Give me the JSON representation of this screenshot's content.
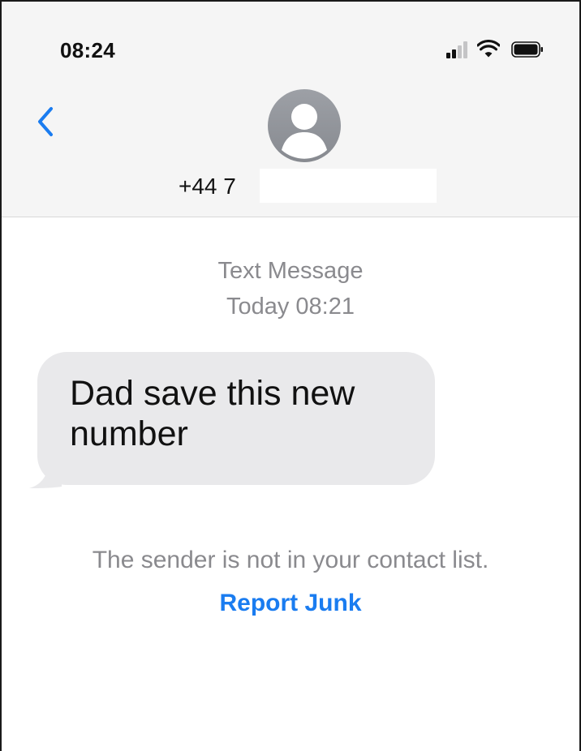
{
  "status_bar": {
    "time": "08:24",
    "icons": [
      "cellular-signal-icon",
      "wifi-icon",
      "battery-icon"
    ]
  },
  "header": {
    "back_icon": "chevron-left-icon",
    "avatar_icon": "person-avatar-icon",
    "contact_number": "+44 7"
  },
  "conversation": {
    "message_type": "Text Message",
    "timestamp": "Today 08:21",
    "messages": [
      {
        "direction": "incoming",
        "text": "Dad save this new number"
      }
    ]
  },
  "junk_notice": {
    "text": "The sender is not in your contact list.",
    "report_label": "Report Junk"
  },
  "colors": {
    "accent": "#1a7cf0",
    "header_bg": "#f5f5f5",
    "bubble_incoming": "#e9e9eb",
    "secondary_text": "#8a8a8e",
    "avatar": "#8e9196"
  }
}
